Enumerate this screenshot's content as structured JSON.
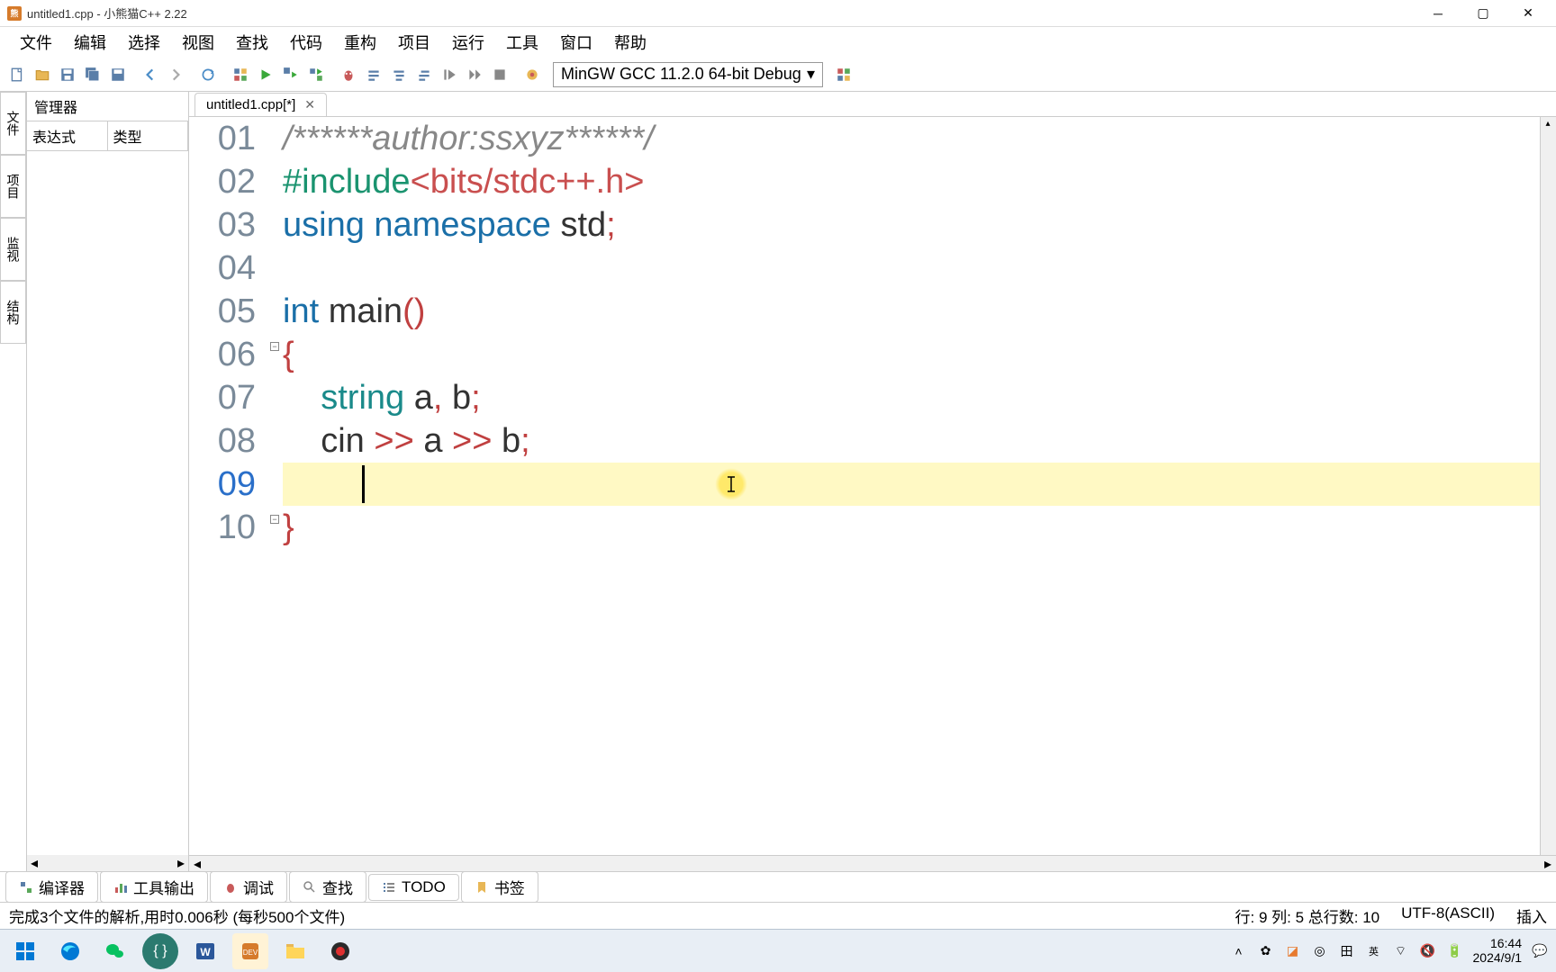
{
  "window": {
    "title": "untitled1.cpp - 小熊猫C++ 2.22"
  },
  "menubar": {
    "items": [
      "文件",
      "编辑",
      "选择",
      "视图",
      "查找",
      "代码",
      "重构",
      "项目",
      "运行",
      "工具",
      "窗口",
      "帮助"
    ]
  },
  "toolbar": {
    "compiler": "MinGW GCC 11.2.0 64-bit Debug"
  },
  "left_vtabs": {
    "items": [
      "文件",
      "项目",
      "监视",
      "结构"
    ]
  },
  "manager": {
    "title": "管理器",
    "tabs": [
      "表达式",
      "类型"
    ]
  },
  "editor": {
    "tab_label": "untitled1.cpp[*]",
    "lines_nums": [
      "01",
      "02",
      "03",
      "04",
      "05",
      "06",
      "07",
      "08",
      "09",
      "10"
    ],
    "current_line_index": 8,
    "code": {
      "l1_comment": "/******author:ssxyz******/",
      "l2_pp": "#include",
      "l2_header": "<bits/stdc++.h>",
      "l3_using": "using",
      "l3_ns": "namespace",
      "l3_std": "std",
      "l3_semi": ";",
      "l5_int": "int",
      "l5_main": "main",
      "l5_paren": "()",
      "l6_brace": "{",
      "l7_type": "string",
      "l7_rest_a": "a",
      "l7_comma": ",",
      "l7_rest_b": "b",
      "l7_semi": ";",
      "l8_cin": "cin",
      "l8_op1": ">>",
      "l8_a": "a",
      "l8_op2": ">>",
      "l8_b": "b",
      "l8_semi": ";",
      "l10_brace": "}"
    }
  },
  "bottom_tabs": {
    "items": [
      "编译器",
      "工具输出",
      "调试",
      "查找",
      "TODO",
      "书签"
    ]
  },
  "statusbar": {
    "left": "完成3个文件的解析,用时0.006秒 (每秒500个文件)",
    "pos": "行: 9 列: 5 总行数: 10",
    "encoding": "UTF-8(ASCII)",
    "mode": "插入"
  },
  "taskbar": {
    "time": "16:44",
    "date": "2024/9/1"
  }
}
